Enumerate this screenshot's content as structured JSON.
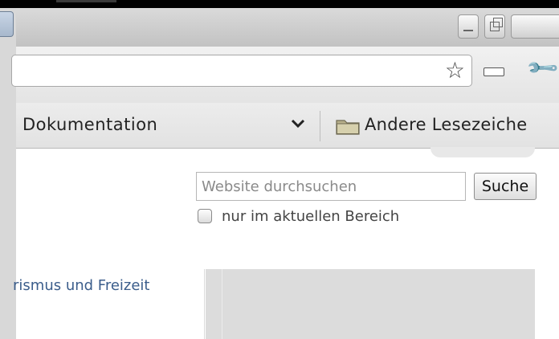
{
  "toolbar": {
    "address_value": "",
    "star_icon": "star-icon",
    "wrench_icon": "wrench-icon"
  },
  "bookmarks": {
    "visible_bookmark": "Dokumentation",
    "other_bookmarks": "Andere Lesezeiche"
  },
  "search": {
    "placeholder": "Website durchsuchen",
    "button_label": "Suche",
    "scope_label": "nur im aktuellen Bereich",
    "scope_checked": false
  },
  "nav": {
    "link_text": "rismus und Freizeit"
  }
}
